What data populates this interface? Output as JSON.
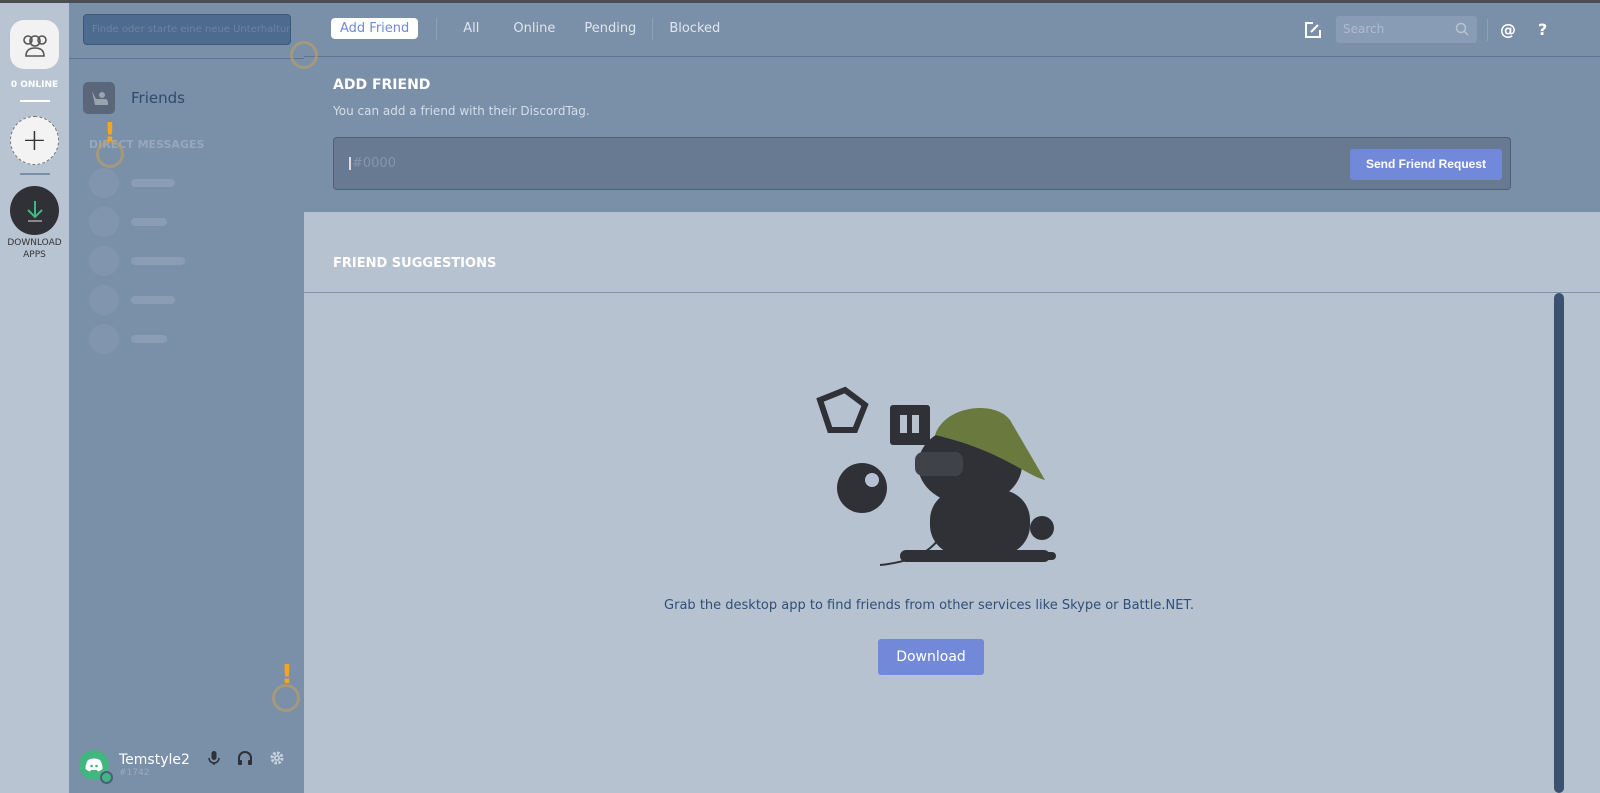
{
  "rail": {
    "online": "0 ONLINE",
    "download_label_1": "DOWNLOAD",
    "download_label_2": "APPS"
  },
  "sidebar": {
    "search_placeholder": "Finde oder starte eine neue Unterhaltung",
    "friends": "Friends",
    "dm_header": "DIRECT MESSAGES"
  },
  "user": {
    "name": "Temstyle2",
    "tag": "#1742"
  },
  "tabs": [
    {
      "label": "Add Friend",
      "active": true
    },
    {
      "label": "All"
    },
    {
      "label": "Online"
    },
    {
      "label": "Pending"
    },
    {
      "label": "Blocked"
    }
  ],
  "toolbar": {
    "search_placeholder": "Search",
    "mention": "@",
    "help": "?"
  },
  "add_friend": {
    "title": "ADD FRIEND",
    "subtitle": "You can add a friend with their DiscordTag.",
    "input_placeholder": "#0000",
    "button": "Send Friend Request"
  },
  "suggestions": {
    "title": "FRIEND SUGGESTIONS",
    "message": "Grab the desktop app to find friends from other services like Skype or Battle.NET.",
    "button": "Download"
  },
  "colors": {
    "accent": "#7289da",
    "online": "#43b581"
  }
}
